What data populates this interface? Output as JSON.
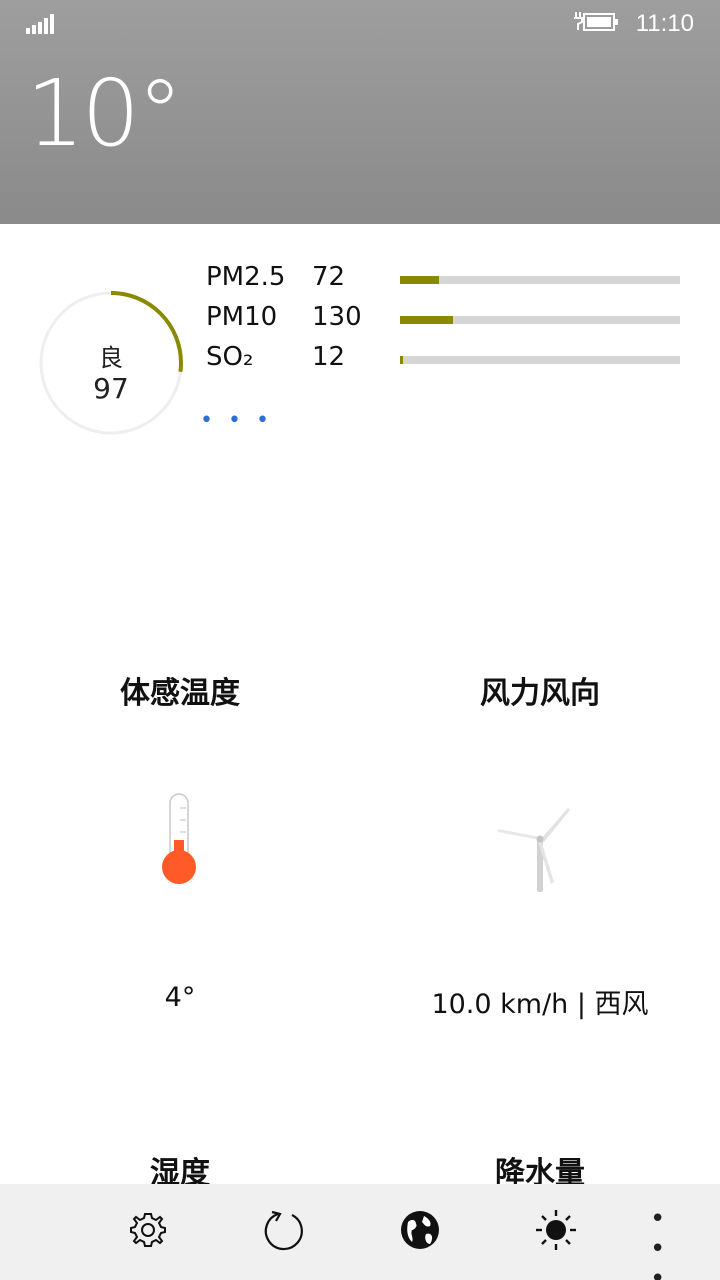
{
  "status_bar": {
    "time": "11:10",
    "signal_icon": "signal-strength-icon",
    "battery_icon": "battery-charging-icon"
  },
  "current": {
    "temperature": "10°"
  },
  "aqi": {
    "level": "良",
    "value": "97",
    "ring_fraction": 0.27,
    "ring_color": "#8a8a00",
    "more": "• • •"
  },
  "pollutants": [
    {
      "name": "PM2.5",
      "value": "72",
      "fill": 0.14
    },
    {
      "name": "PM10",
      "value": "130",
      "fill": 0.19
    },
    {
      "name": "SO₂",
      "value": "12",
      "fill": 0.01
    }
  ],
  "tiles": {
    "feels_like": {
      "title": "体感温度",
      "value": "4°",
      "icon": "thermometer-icon"
    },
    "wind": {
      "title": "风力风向",
      "value": "10.0 km/h | 西风",
      "icon": "wind-turbine-icon"
    },
    "humidity": {
      "title": "湿度"
    },
    "precipitation": {
      "title": "降水量"
    }
  },
  "appbar": {
    "buttons": [
      "settings-icon",
      "refresh-icon",
      "globe-icon",
      "brightness-icon"
    ],
    "more": "• • •"
  },
  "colors": {
    "header_bg": "#959595",
    "accent_bar": "#8a8a00",
    "bar_track": "#d6d6d6",
    "thermometer_bulb": "#ff5a28",
    "more_dots": "#2b6ed6",
    "appbar_bg": "#f0f0f0"
  }
}
